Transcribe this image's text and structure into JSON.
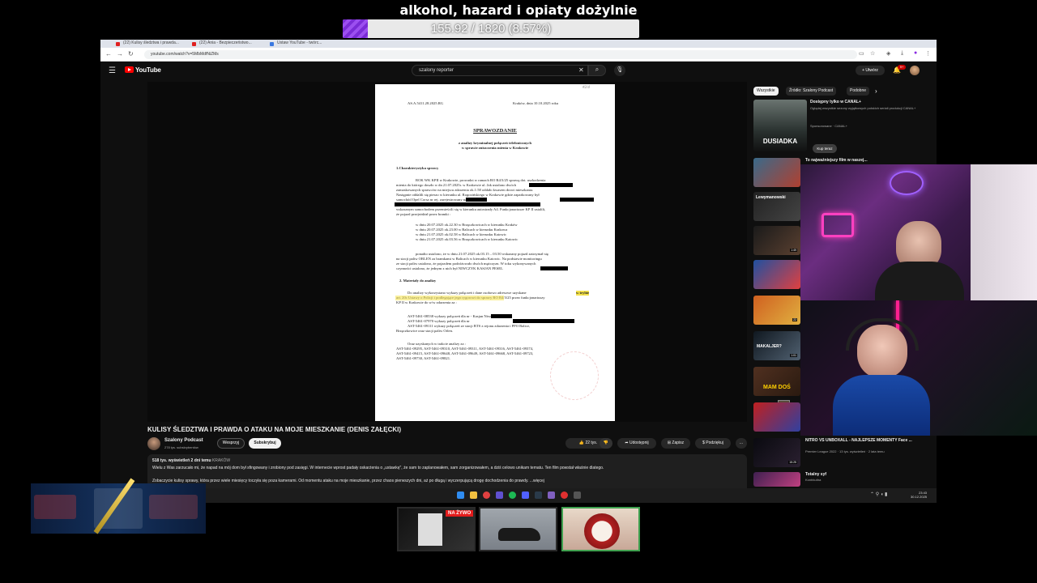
{
  "overlay": {
    "title": "alkohol, hazard i opiaty dożylnie",
    "goal_text": "155.92 / 1820 (8.57%)",
    "goal_fraction": 0.0857
  },
  "browser": {
    "tabs": [
      "(22) Kulisy śledztwa i prawda...",
      "(22) Ania - Bezpieczeństwo...",
      "Ustaw YouTube - twórc..."
    ],
    "url": "youtube.com/watch?v=5MbMdfNiZMs"
  },
  "youtube": {
    "logo_text": "YouTube",
    "search_query": "szalony reporter",
    "create_label": "Utwórz",
    "notif_count": "9+",
    "video_title": "KULISY ŚLEDZTWA I PRAWDA O ATAKU NA MOJE MIESZKANIE (DENIS ZAŁĘCKI)",
    "channel_name": "Szalony Podcast",
    "channel_subs": "278 tys. subskrybentów",
    "join_label": "Wesprzyj",
    "subscribe_label": "Subskrybuj",
    "likes_label": "22 tys.",
    "share_label": "Udostępnij",
    "save_label": "Zapisz",
    "thanks_label": "Podziękuj",
    "more_label": "...",
    "desc_stats": "518 tys. wyświetleń  2 dni temu",
    "desc_tag": "KRAKÓW",
    "desc_line1": "Wielu z Was zarzucało mi, że napad na mój dom był sfingowany i zrobiony pod zasięgi. W internecie wprost padały oskarżenia o „ustawkę\", że sam to zaplanowałem, sam zorganizowałem, a dziś celowo unikam tematu. Ten film powstał właśnie dlatego.",
    "desc_line2": "Zobaczycie kulisy sprawy, która przez wiele miesięcy toczyła się poza kamerami. Od momentu ataku na moje mieszkanie, przez chaos pierwszych dni, aż po długą i wyczerpującą drogę dochodzenia do prawdy. ...więcej"
  },
  "document": {
    "ref": "AS.A.5411.28.2025.RG",
    "place_date": "Kraków, dnia  10.10.2025 roku",
    "corner_note": "#2/4",
    "heading": "SPRAWOZDANIE",
    "subheading1": "z analizy kryminalnej połączeń telefonicznych",
    "subheading2": "w sprawie zniszczenia mienia w Krakowie",
    "section1": "1.Charakterystyka sprawy",
    "s1_lines": [
      "ROK WK KPII w Krakowie, prowadzi w ramach RO R4/3/25 sprawę dot. uszkodzenia",
      "mienia do którego doszło w dn 21.07.2025r. w Krakowie ul.               Jak ustalono dwóch",
      "zamaskowanych sprawców na miejscu zdarzenia ok.1:58 oddało kwasem drzwi mieszkania.",
      "Następnie oddalili się pieszo w kierunku ul. Rogozińskiego w Krakowie gdzie zaparkowany był",
      "samochód  Opel  Corsa  nr  rej.               zarejestrowany  na  nazwisko",
      "                                                   Następnie ustalono, że sprawcy",
      "wskazanym samochodem przemieścili się w kierunku autostrady A4. Funkcjonariusze KP II ustalili,",
      "że pojazd przejeżdżał przez bramki :"
    ],
    "gates": [
      "w dniu 20.07.2025 ok.22.30 w Brzęczkowicach w kierunku Kraków",
      "w dniu 20.07.2025 ok.23.00 w Balicach w kierunku Krakowa",
      "w dniu 21.07.2025 ok.02.58 w Balicach w kierunku Katowic",
      "w dniu 21.07.2025 ok.03.56 w Brzęczkowicach w kierunku Katowic"
    ],
    "s1_after": [
      "ponadto ustalono, że w dniu 21.07.2025 ok.03.15 – 03.50 wskazany pojazd zatrzymał się",
      "na stacji paliw ORLEN  za bramkami w Balicach w kierunku Katowic. Na podstawie monitoringu",
      "ze stacji paliw ustalono, że pojazdem podróżowało dwóch mężczyzn. W toku wykonywanych",
      "czynności ustalono, że jednym z nich był NIWCZYK KASJAN PESEL"
    ],
    "section2": "2. Materiały do analizy",
    "s2_lines": [
      "Do  analizy  wykorzystano  wykazy  połączeń  i  dane  osobowo  adresowe  uzyskane",
      "art. 20c Ustawy o Policji i podlegające jego rygorowi do sprawy RO R4/3/25 przez funkcjonariuszy",
      "KP II w Krakowie do w/w zdarzenia za :"
    ],
    "s2_inline_hl": "w trybie",
    "ast_lines": [
      "AST-5461-08538 wykazy połączeń dla nr               - Kasjan Niwczyk",
      "AST-5461-07970 wykazy połączeń dla nr",
      "AST-5461-09111  wykazy  połączeń  ze  stacji  BTS  z  rejonu  zdarzenia  i  PPO  Balice,",
      "Brzęczkowice oraz stacji paliw Orlen."
    ],
    "other_lines": [
      "Oraz uzyskanych w trakcie analizy za :",
      "AST-5461-09295,  AST-5461-09310,  AST-5461-09311,  AST-5461-09316,  AST-5461-09374,",
      "AST-5461-09415,  AST-5461-09648,  AST-5461-09649,  AST-5461-09668,  AST-5461-09723,",
      "AST-5461-09730, AST-5461-09821."
    ]
  },
  "sidebar": {
    "chips": [
      "Wszystkie",
      "Źródło: Szalony Podcast",
      "Podobne"
    ],
    "recs": [
      {
        "title": "Dostępny tylko w CANAL+",
        "meta": "Oglądaj wszystkie sezony wyjątkowych polskich seriali produkcji CANAL+",
        "sponsor": "Sponsorowane · CANAL+",
        "thumb_text": "DUSIADKA",
        "dur": ""
      },
      {
        "title": "To najważniejszy film w naszej...",
        "meta": "",
        "thumb_text": "",
        "dur": ""
      },
      {
        "title": "",
        "meta": "",
        "thumb_text": "Lewymanowski",
        "dur": ""
      },
      {
        "title": "",
        "meta": "",
        "thumb_text": "",
        "dur": "1:49"
      },
      {
        "title": "",
        "meta": "",
        "thumb_text": "",
        "dur": ""
      },
      {
        "title": "",
        "meta": "",
        "thumb_text": "",
        "dur": "22"
      },
      {
        "title": "",
        "meta": "",
        "thumb_text": "MAKALJER?",
        "dur": "1:01"
      },
      {
        "title": "",
        "meta": "",
        "thumb_text": "MAM DOŚ",
        "dur": ""
      },
      {
        "title": "",
        "meta": "",
        "thumb_text": "",
        "dur": ""
      },
      {
        "title": "NITRO VS UNBOXALL - NAJLEPSZE MOMENTY Face ...",
        "meta": "Premier League 2022 · 13 tys. wyświetleń · 2 lata temu",
        "thumb_text": "",
        "dur": "15:25"
      },
      {
        "title": "Totalny syf",
        "meta": "Kontrkultra",
        "thumb_text": "",
        "dur": ""
      }
    ],
    "ad_button": "Kup teraz"
  },
  "taskbar": {
    "time": "23:43",
    "date": "30.12.2025"
  },
  "bottom": {
    "live_badge": "NA ŻYWO"
  },
  "colors": {
    "yt_bg": "#0f0f0f",
    "yt_red": "#ff0000",
    "goal_purple": "#7a2bd6",
    "highlight": "#f4e14a"
  }
}
